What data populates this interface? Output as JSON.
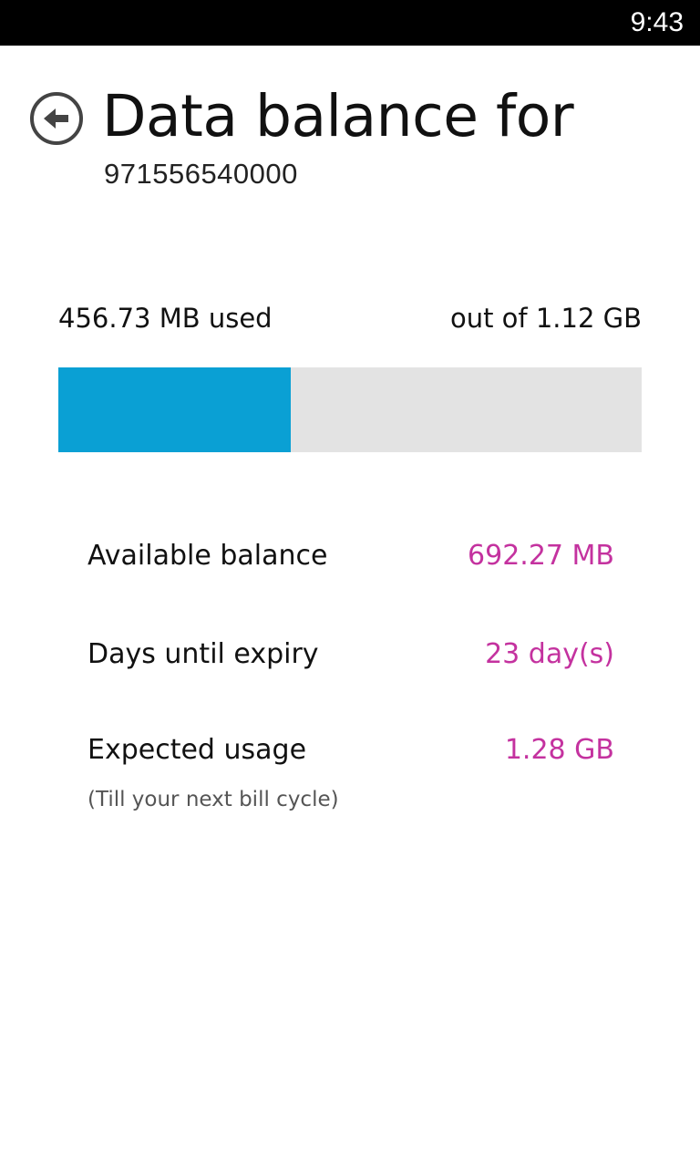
{
  "status_bar": {
    "time": "9:43"
  },
  "header": {
    "back_icon": "arrow-left-circle-icon",
    "title": "Data balance for",
    "subtitle": "971556540000"
  },
  "usage": {
    "used_label": "456.73 MB used",
    "total_label": "out of 1.12 GB",
    "used_mb": 456.73,
    "total_gb": 1.12,
    "progress_fraction": 0.398
  },
  "stats": [
    {
      "label": "Available balance",
      "value": "692.27 MB"
    },
    {
      "label": "Days until expiry",
      "value": "23 day(s)"
    },
    {
      "label": "Expected usage",
      "value": "1.28 GB",
      "note": "(Till your next bill cycle)"
    }
  ],
  "colors": {
    "accent": "#0aa0d4",
    "value_text": "#c4329f",
    "track": "#e3e3e3",
    "status_bar": "#000000"
  }
}
